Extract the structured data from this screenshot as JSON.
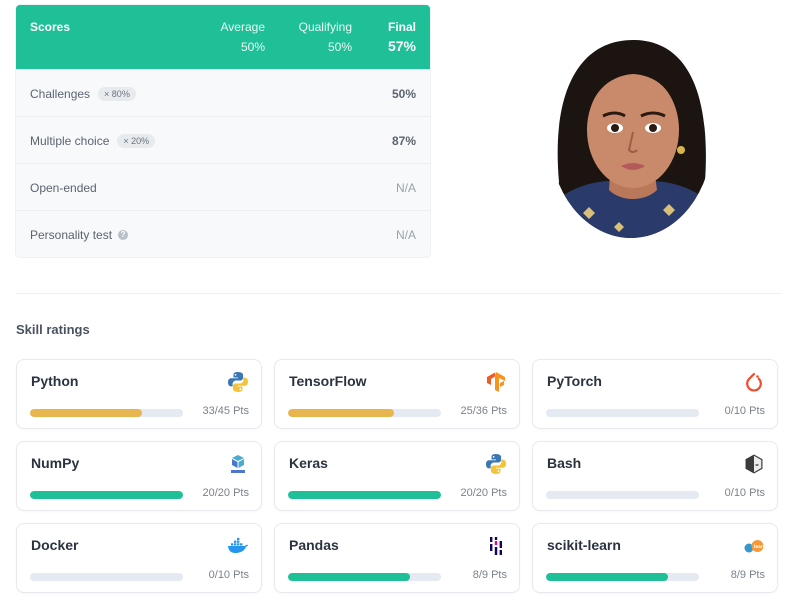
{
  "scores": {
    "header": {
      "label": "Scores",
      "average": {
        "caption": "Average",
        "value": "50%"
      },
      "qualifying": {
        "caption": "Qualifying",
        "value": "50%"
      },
      "final": {
        "caption": "Final",
        "value": "57%"
      }
    },
    "rows": [
      {
        "label": "Challenges",
        "tag": "× 80%",
        "value": "50%"
      },
      {
        "label": "Multiple choice",
        "tag": "× 20%",
        "value": "87%"
      },
      {
        "label": "Open-ended",
        "value": "N/A"
      },
      {
        "label": "Personality test",
        "value": "N/A"
      }
    ]
  },
  "skills": {
    "title": "Skill ratings",
    "items": [
      {
        "name": "Python",
        "points": "33/45 Pts",
        "fraction": 0.733,
        "bar_color": "#e8b64f",
        "icon": "python-icon"
      },
      {
        "name": "TensorFlow",
        "points": "25/36 Pts",
        "fraction": 0.694,
        "bar_color": "#e8b64f",
        "icon": "tensorflow-icon"
      },
      {
        "name": "PyTorch",
        "points": "0/10 Pts",
        "fraction": 0,
        "bar_color": "#1fbf97",
        "icon": "pytorch-icon"
      },
      {
        "name": "NumPy",
        "points": "20/20 Pts",
        "fraction": 1,
        "bar_color": "#1fbf97",
        "icon": "numpy-icon"
      },
      {
        "name": "Keras",
        "points": "20/20 Pts",
        "fraction": 1,
        "bar_color": "#1fbf97",
        "icon": "python-icon"
      },
      {
        "name": "Bash",
        "points": "0/10 Pts",
        "fraction": 0,
        "bar_color": "#1fbf97",
        "icon": "bash-icon"
      },
      {
        "name": "Docker",
        "points": "0/10 Pts",
        "fraction": 0,
        "bar_color": "#1fbf97",
        "icon": "docker-icon"
      },
      {
        "name": "Pandas",
        "points": "8/9 Pts",
        "fraction": 0.8,
        "bar_color": "#1fbf97",
        "icon": "pandas-icon"
      },
      {
        "name": "scikit-learn",
        "points": "8/9 Pts",
        "fraction": 0.8,
        "bar_color": "#1fbf97",
        "icon": "scikit-learn-icon"
      }
    ]
  },
  "colors": {
    "accent": "#1fbf97",
    "partial": "#e8b64f",
    "track": "#e4e9f2"
  }
}
